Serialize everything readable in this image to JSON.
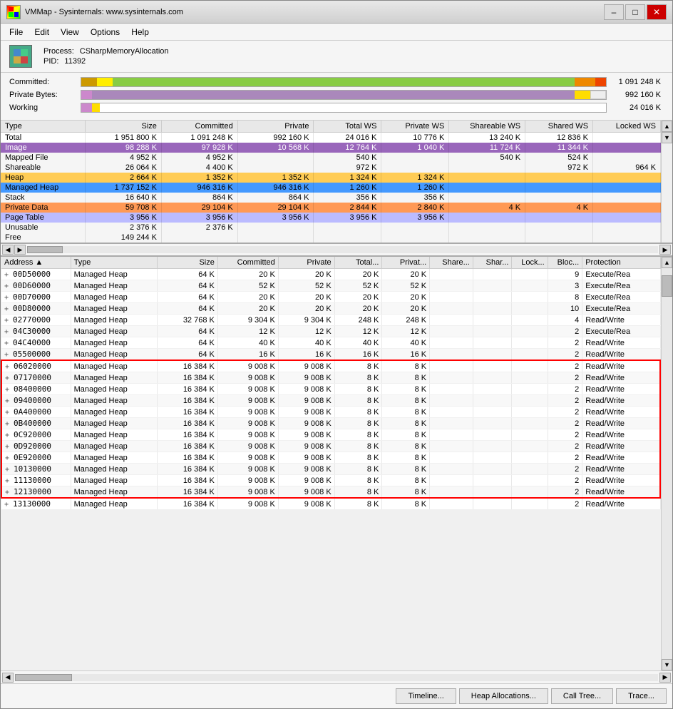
{
  "window": {
    "title": "VMMap - Sysinternals: www.sysinternals.com"
  },
  "menu": {
    "items": [
      "File",
      "Edit",
      "View",
      "Options",
      "Help"
    ]
  },
  "process": {
    "label_name": "Process:",
    "name": "CSharpMemoryAllocation",
    "label_pid": "PID:",
    "pid": "11392"
  },
  "committed": {
    "label": "Committed:",
    "value": "1 091 248 K"
  },
  "private_bytes": {
    "label": "Private Bytes:",
    "value": "992 160 K"
  },
  "working": {
    "label": "Working",
    "value": "24 016 K"
  },
  "top_table": {
    "headers": [
      "Type",
      "Size",
      "Committed",
      "Private",
      "Total WS",
      "Private WS",
      "Shareable WS",
      "Shared WS",
      "Locked WS"
    ],
    "rows": [
      {
        "type": "Total",
        "size": "1 951 800 K",
        "committed": "1 091 248 K",
        "private": "992 160 K",
        "total_ws": "24 016 K",
        "private_ws": "10 776 K",
        "shareable_ws": "13 240 K",
        "shared_ws": "12 836 K",
        "locked_ws": "",
        "style": "total"
      },
      {
        "type": "Image",
        "size": "98 288 K",
        "committed": "97 928 K",
        "private": "10 568 K",
        "total_ws": "12 764 K",
        "private_ws": "1 040 K",
        "shareable_ws": "11 724 K",
        "shared_ws": "11 344 K",
        "locked_ws": "",
        "style": "image"
      },
      {
        "type": "Mapped File",
        "size": "4 952 K",
        "committed": "4 952 K",
        "private": "",
        "total_ws": "540 K",
        "private_ws": "",
        "shareable_ws": "540 K",
        "shared_ws": "524 K",
        "locked_ws": "",
        "style": "mapped"
      },
      {
        "type": "Shareable",
        "size": "26 064 K",
        "committed": "4 400 K",
        "private": "",
        "total_ws": "972 K",
        "private_ws": "",
        "shareable_ws": "",
        "shared_ws": "972 K",
        "locked_ws": "964 K",
        "style": "shareable"
      },
      {
        "type": "Heap",
        "size": "2 664 K",
        "committed": "1 352 K",
        "private": "1 352 K",
        "total_ws": "1 324 K",
        "private_ws": "1 324 K",
        "shareable_ws": "",
        "shared_ws": "",
        "locked_ws": "",
        "style": "heap"
      },
      {
        "type": "Managed Heap",
        "size": "1 737 152 K",
        "committed": "946 316 K",
        "private": "946 316 K",
        "total_ws": "1 260 K",
        "private_ws": "1 260 K",
        "shareable_ws": "",
        "shared_ws": "",
        "locked_ws": "",
        "style": "managed-heap"
      },
      {
        "type": "Stack",
        "size": "16 640 K",
        "committed": "864 K",
        "private": "864 K",
        "total_ws": "356 K",
        "private_ws": "356 K",
        "shareable_ws": "",
        "shared_ws": "",
        "locked_ws": "",
        "style": "stack"
      },
      {
        "type": "Private Data",
        "size": "59 708 K",
        "committed": "29 104 K",
        "private": "29 104 K",
        "total_ws": "2 844 K",
        "private_ws": "2 840 K",
        "shareable_ws": "4 K",
        "shared_ws": "4 K",
        "locked_ws": "",
        "style": "private"
      },
      {
        "type": "Page Table",
        "size": "3 956 K",
        "committed": "3 956 K",
        "private": "3 956 K",
        "total_ws": "3 956 K",
        "private_ws": "3 956 K",
        "shareable_ws": "",
        "shared_ws": "",
        "locked_ws": "",
        "style": "page-table"
      },
      {
        "type": "Unusable",
        "size": "2 376 K",
        "committed": "2 376 K",
        "private": "",
        "total_ws": "",
        "private_ws": "",
        "shareable_ws": "",
        "shared_ws": "",
        "locked_ws": "",
        "style": "unusable"
      },
      {
        "type": "Free",
        "size": "149 244 K",
        "committed": "",
        "private": "",
        "total_ws": "",
        "private_ws": "",
        "shareable_ws": "",
        "shared_ws": "",
        "locked_ws": "",
        "style": "free"
      }
    ]
  },
  "detail_table": {
    "headers": [
      "Address",
      "Type",
      "Size",
      "Committed",
      "Private",
      "Total...",
      "Privat...",
      "Share...",
      "Shar...",
      "Lock...",
      "Bloc...",
      "Protection"
    ],
    "rows": [
      {
        "addr": "00D50000",
        "type": "Managed Heap",
        "size": "64 K",
        "committed": "20 K",
        "private": "20 K",
        "total": "20 K",
        "privat": "20 K",
        "share": "",
        "shar": "",
        "lock": "",
        "bloc": "9",
        "prot": "Execute/Rea",
        "selected": false,
        "highlight": false
      },
      {
        "addr": "00D60000",
        "type": "Managed Heap",
        "size": "64 K",
        "committed": "52 K",
        "private": "52 K",
        "total": "52 K",
        "privat": "52 K",
        "share": "",
        "shar": "",
        "lock": "",
        "bloc": "3",
        "prot": "Execute/Rea",
        "selected": false,
        "highlight": false
      },
      {
        "addr": "00D70000",
        "type": "Managed Heap",
        "size": "64 K",
        "committed": "20 K",
        "private": "20 K",
        "total": "20 K",
        "privat": "20 K",
        "share": "",
        "shar": "",
        "lock": "",
        "bloc": "8",
        "prot": "Execute/Rea",
        "selected": false,
        "highlight": false
      },
      {
        "addr": "00D80000",
        "type": "Managed Heap",
        "size": "64 K",
        "committed": "20 K",
        "private": "20 K",
        "total": "20 K",
        "privat": "20 K",
        "share": "",
        "shar": "",
        "lock": "",
        "bloc": "10",
        "prot": "Execute/Rea",
        "selected": false,
        "highlight": false
      },
      {
        "addr": "02770000",
        "type": "Managed Heap",
        "size": "32 768 K",
        "committed": "9 304 K",
        "private": "9 304 K",
        "total": "248 K",
        "privat": "248 K",
        "share": "",
        "shar": "",
        "lock": "",
        "bloc": "4",
        "prot": "Read/Write",
        "selected": false,
        "highlight": false
      },
      {
        "addr": "04C30000",
        "type": "Managed Heap",
        "size": "64 K",
        "committed": "12 K",
        "private": "12 K",
        "total": "12 K",
        "privat": "12 K",
        "share": "",
        "shar": "",
        "lock": "",
        "bloc": "2",
        "prot": "Execute/Rea",
        "selected": false,
        "highlight": false
      },
      {
        "addr": "04C40000",
        "type": "Managed Heap",
        "size": "64 K",
        "committed": "40 K",
        "private": "40 K",
        "total": "40 K",
        "privat": "40 K",
        "share": "",
        "shar": "",
        "lock": "",
        "bloc": "2",
        "prot": "Read/Write",
        "selected": false,
        "highlight": false
      },
      {
        "addr": "05500000",
        "type": "Managed Heap",
        "size": "64 K",
        "committed": "16 K",
        "private": "16 K",
        "total": "16 K",
        "privat": "16 K",
        "share": "",
        "shar": "",
        "lock": "",
        "bloc": "2",
        "prot": "Read/Write",
        "selected": false,
        "highlight": false
      },
      {
        "addr": "06020000",
        "type": "Managed Heap",
        "size": "16 384 K",
        "committed": "9 008 K",
        "private": "9 008 K",
        "total": "8 K",
        "privat": "8 K",
        "share": "",
        "shar": "",
        "lock": "",
        "bloc": "2",
        "prot": "Read/Write",
        "selected": false,
        "highlight": true
      },
      {
        "addr": "07170000",
        "type": "Managed Heap",
        "size": "16 384 K",
        "committed": "9 008 K",
        "private": "9 008 K",
        "total": "8 K",
        "privat": "8 K",
        "share": "",
        "shar": "",
        "lock": "",
        "bloc": "2",
        "prot": "Read/Write",
        "selected": false,
        "highlight": true
      },
      {
        "addr": "08400000",
        "type": "Managed Heap",
        "size": "16 384 K",
        "committed": "9 008 K",
        "private": "9 008 K",
        "total": "8 K",
        "privat": "8 K",
        "share": "",
        "shar": "",
        "lock": "",
        "bloc": "2",
        "prot": "Read/Write",
        "selected": false,
        "highlight": true
      },
      {
        "addr": "09400000",
        "type": "Managed Heap",
        "size": "16 384 K",
        "committed": "9 008 K",
        "private": "9 008 K",
        "total": "8 K",
        "privat": "8 K",
        "share": "",
        "shar": "",
        "lock": "",
        "bloc": "2",
        "prot": "Read/Write",
        "selected": false,
        "highlight": true
      },
      {
        "addr": "0A400000",
        "type": "Managed Heap",
        "size": "16 384 K",
        "committed": "9 008 K",
        "private": "9 008 K",
        "total": "8 K",
        "privat": "8 K",
        "share": "",
        "shar": "",
        "lock": "",
        "bloc": "2",
        "prot": "Read/Write",
        "selected": false,
        "highlight": true
      },
      {
        "addr": "0B400000",
        "type": "Managed Heap",
        "size": "16 384 K",
        "committed": "9 008 K",
        "private": "9 008 K",
        "total": "8 K",
        "privat": "8 K",
        "share": "",
        "shar": "",
        "lock": "",
        "bloc": "2",
        "prot": "Read/Write",
        "selected": false,
        "highlight": true
      },
      {
        "addr": "0C920000",
        "type": "Managed Heap",
        "size": "16 384 K",
        "committed": "9 008 K",
        "private": "9 008 K",
        "total": "8 K",
        "privat": "8 K",
        "share": "",
        "shar": "",
        "lock": "",
        "bloc": "2",
        "prot": "Read/Write",
        "selected": false,
        "highlight": true
      },
      {
        "addr": "0D920000",
        "type": "Managed Heap",
        "size": "16 384 K",
        "committed": "9 008 K",
        "private": "9 008 K",
        "total": "8 K",
        "privat": "8 K",
        "share": "",
        "shar": "",
        "lock": "",
        "bloc": "2",
        "prot": "Read/Write",
        "selected": false,
        "highlight": true
      },
      {
        "addr": "0E920000",
        "type": "Managed Heap",
        "size": "16 384 K",
        "committed": "9 008 K",
        "private": "9 008 K",
        "total": "8 K",
        "privat": "8 K",
        "share": "",
        "shar": "",
        "lock": "",
        "bloc": "2",
        "prot": "Read/Write",
        "selected": false,
        "highlight": true
      },
      {
        "addr": "10130000",
        "type": "Managed Heap",
        "size": "16 384 K",
        "committed": "9 008 K",
        "private": "9 008 K",
        "total": "8 K",
        "privat": "8 K",
        "share": "",
        "shar": "",
        "lock": "",
        "bloc": "2",
        "prot": "Read/Write",
        "selected": false,
        "highlight": true
      },
      {
        "addr": "11130000",
        "type": "Managed Heap",
        "size": "16 384 K",
        "committed": "9 008 K",
        "private": "9 008 K",
        "total": "8 K",
        "privat": "8 K",
        "share": "",
        "shar": "",
        "lock": "",
        "bloc": "2",
        "prot": "Read/Write",
        "selected": false,
        "highlight": true
      },
      {
        "addr": "12130000",
        "type": "Managed Heap",
        "size": "16 384 K",
        "committed": "9 008 K",
        "private": "9 008 K",
        "total": "8 K",
        "privat": "8 K",
        "share": "",
        "shar": "",
        "lock": "",
        "bloc": "2",
        "prot": "Read/Write",
        "selected": false,
        "highlight": true
      },
      {
        "addr": "13130000",
        "type": "Managed Heap",
        "size": "16 384 K",
        "committed": "9 008 K",
        "private": "9 008 K",
        "total": "8 K",
        "privat": "8 K",
        "share": "",
        "shar": "",
        "lock": "",
        "bloc": "2",
        "prot": "Read/Write",
        "selected": false,
        "highlight": false
      }
    ]
  },
  "buttons": {
    "timeline": "Timeline...",
    "heap_allocations": "Heap Allocations...",
    "call_tree": "Call Tree...",
    "trace": "Trace..."
  }
}
